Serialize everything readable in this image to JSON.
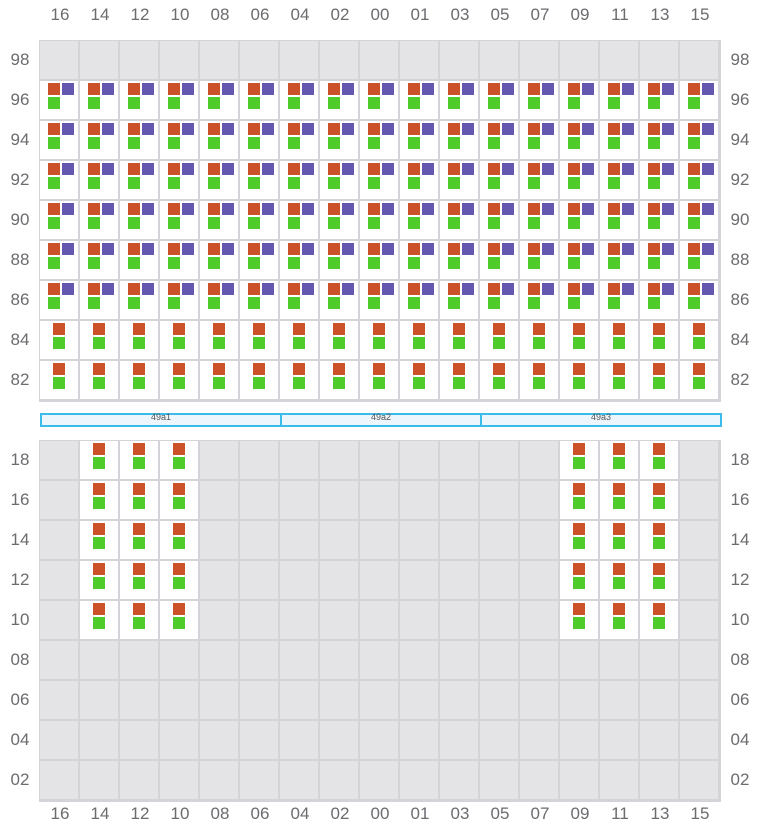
{
  "colors": {
    "red": "#cb5129",
    "purple": "#6457b0",
    "green": "#4fcc2b",
    "empty": "#e4e4e7",
    "band": "#3bbbe8"
  },
  "columns": [
    "16",
    "14",
    "12",
    "10",
    "08",
    "06",
    "04",
    "02",
    "00",
    "01",
    "03",
    "05",
    "07",
    "09",
    "11",
    "13",
    "15"
  ],
  "upper": {
    "rows": [
      "98",
      "96",
      "94",
      "92",
      "90",
      "88",
      "86",
      "84",
      "82"
    ],
    "row_kinds": [
      "empty",
      "rpg",
      "rpg",
      "rpg",
      "rpg",
      "rpg",
      "rpg",
      "rg",
      "rg"
    ]
  },
  "bands": [
    {
      "label": "49a1",
      "from": 0,
      "to": 6
    },
    {
      "label": "49a2",
      "from": 6,
      "to": 11
    },
    {
      "label": "49a3",
      "from": 11,
      "to": 17
    }
  ],
  "lower": {
    "rows": [
      "18",
      "16",
      "14",
      "12",
      "10",
      "08",
      "06",
      "04",
      "02"
    ],
    "filled_rows": [
      "18",
      "16",
      "14",
      "12",
      "10"
    ],
    "filled_columns": [
      "14",
      "12",
      "10",
      "09",
      "11",
      "13"
    ]
  }
}
